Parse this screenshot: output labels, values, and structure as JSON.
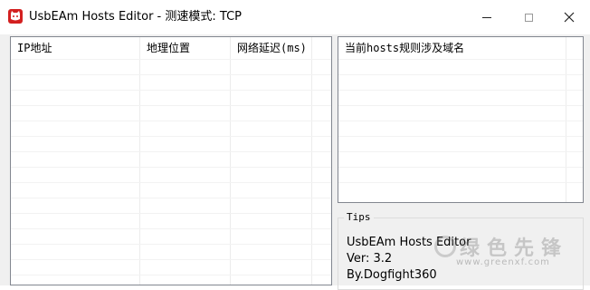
{
  "window": {
    "title": "UsbEAm Hosts Editor - 测速模式: TCP",
    "app_icon": "red-cat-icon",
    "controls": [
      "minimize-icon",
      "maximize-icon",
      "close-icon"
    ]
  },
  "left_list": {
    "columns": [
      "IP地址",
      "地理位置",
      "网络延迟(ms)"
    ]
  },
  "right_list": {
    "columns": [
      "当前hosts规则涉及域名"
    ]
  },
  "tips": {
    "title": "Tips",
    "lines": [
      "UsbEAm Hosts Editor",
      "Ver: 3.2",
      "By.Dogfight360"
    ]
  },
  "watermark": {
    "text": "绿色先锋",
    "url": "www.greenxf.com"
  }
}
